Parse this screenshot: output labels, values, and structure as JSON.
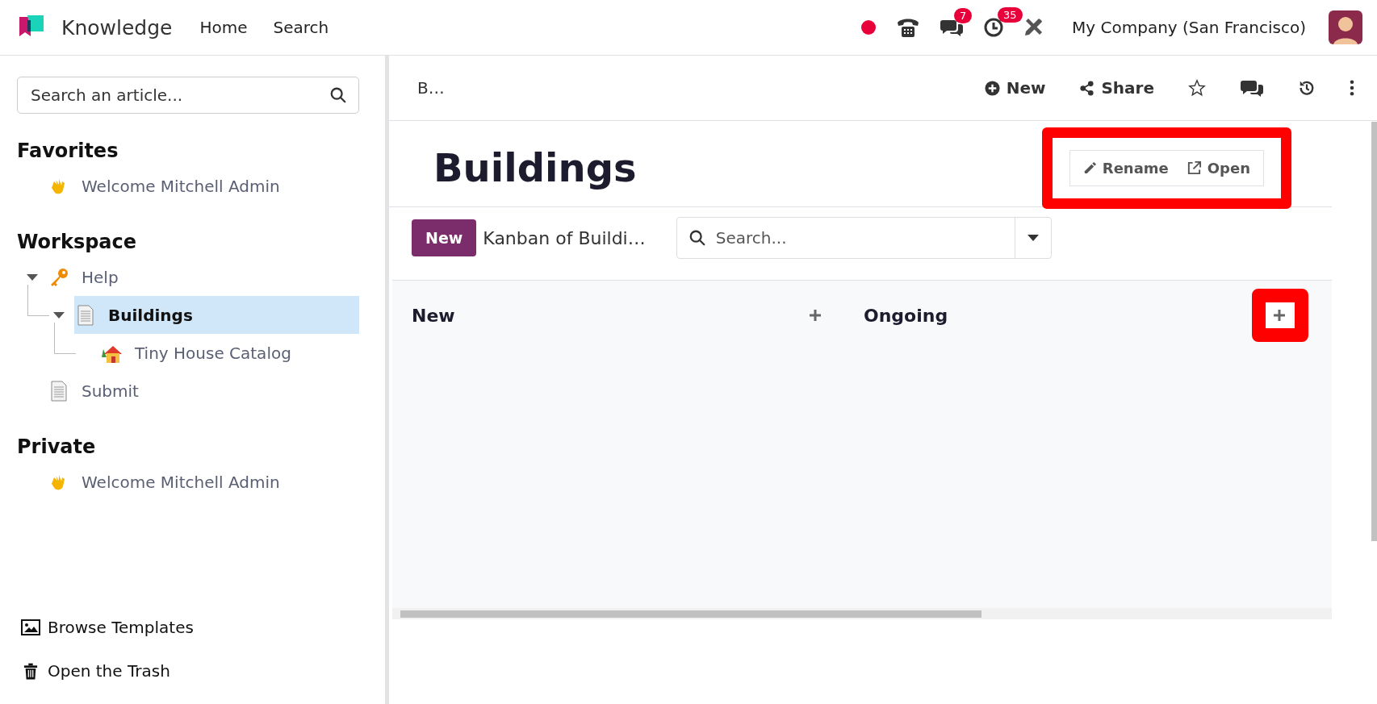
{
  "topbar": {
    "app_name": "Knowledge",
    "menu": [
      "Home",
      "Search"
    ],
    "chat_badge": "7",
    "activity_badge": "35",
    "company": "My Company (San Francisco)"
  },
  "sidebar": {
    "search": {
      "placeholder": "Search an article..."
    },
    "sections": [
      {
        "title": "Favorites",
        "items": [
          {
            "kind": "wave",
            "label": "Welcome Mitchell Admin",
            "selected": false
          }
        ]
      },
      {
        "title": "Workspace",
        "items": [
          {
            "kind": "key",
            "label": "Help",
            "selected": false,
            "expanded": true,
            "children": [
              {
                "kind": "page",
                "label": "Buildings",
                "selected": true,
                "expanded": true,
                "children": [
                  {
                    "kind": "house",
                    "label": "Tiny House Catalog",
                    "selected": false
                  }
                ]
              }
            ]
          },
          {
            "kind": "page",
            "label": "Submit",
            "selected": false
          }
        ]
      },
      {
        "title": "Private",
        "items": [
          {
            "kind": "wave",
            "label": "Welcome Mitchell Admin",
            "selected": false
          }
        ]
      }
    ],
    "footer": [
      {
        "kind": "image",
        "label": "Browse Templates"
      },
      {
        "kind": "trash",
        "label": "Open the Trash"
      }
    ]
  },
  "header": {
    "breadcrumb": "B…",
    "actions": [
      {
        "kind": "new",
        "label": "New"
      },
      {
        "kind": "share",
        "label": "Share"
      },
      {
        "kind": "star"
      },
      {
        "kind": "chat"
      },
      {
        "kind": "history"
      },
      {
        "kind": "more"
      }
    ]
  },
  "article": {
    "title": "Buildings",
    "embed": {
      "highlighted": true,
      "actions": [
        {
          "kind": "rename",
          "label": "Rename"
        },
        {
          "kind": "open",
          "label": "Open"
        }
      ],
      "new_button": "New",
      "view_title": "Kanban of Buildi…",
      "search": {
        "placeholder": "Search..."
      },
      "columns": [
        {
          "title": "New",
          "highlighted": false
        },
        {
          "title": "Ongoing",
          "highlighted": true
        }
      ]
    }
  }
}
